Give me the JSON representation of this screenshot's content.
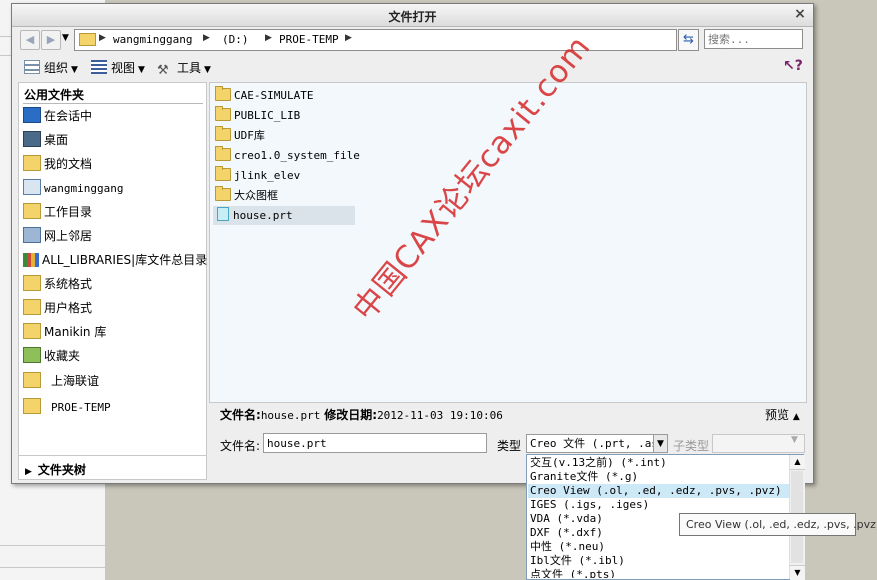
{
  "dialog": {
    "title": "文件打开",
    "close_icon": "close-icon"
  },
  "address": {
    "crumbs": [
      "wangminggang",
      "(D:)",
      "PROE-TEMP"
    ],
    "search_placeholder": "搜索..."
  },
  "toolbar": {
    "organize_label": "组织",
    "view_label": "视图",
    "tools_label": "工具"
  },
  "sidebar": {
    "title": "公用文件夹",
    "items": [
      {
        "label": "在会话中",
        "icon": "session-icon"
      },
      {
        "label": "桌面",
        "icon": "desktop-icon"
      },
      {
        "label": "我的文档",
        "icon": "my-documents-icon"
      },
      {
        "label": "wangminggang",
        "icon": "computer-icon"
      },
      {
        "label": "工作目录",
        "icon": "working-directory-icon"
      },
      {
        "label": "网上邻居",
        "icon": "network-icon"
      },
      {
        "label": "ALL_LIBRARIES|库文件总目录",
        "icon": "library-icon"
      },
      {
        "label": "系统格式",
        "icon": "folder-icon"
      },
      {
        "label": "用户格式",
        "icon": "folder-icon"
      },
      {
        "label": "Manikin 库",
        "icon": "folder-icon"
      },
      {
        "label": "收藏夹",
        "icon": "favorites-icon"
      },
      {
        "label": "上海联谊",
        "icon": "folder-icon"
      },
      {
        "label": "PROE-TEMP",
        "icon": "folder-icon"
      }
    ],
    "tree_toggle": "文件夹树"
  },
  "files": [
    {
      "name": "CAE-SIMULATE",
      "type": "folder"
    },
    {
      "name": "PUBLIC_LIB",
      "type": "folder"
    },
    {
      "name": "UDF库",
      "type": "folder"
    },
    {
      "name": "creo1.0_system_file",
      "type": "folder"
    },
    {
      "name": "jlink_elev",
      "type": "folder"
    },
    {
      "name": "大众图框",
      "type": "folder"
    },
    {
      "name": "house.prt",
      "type": "part",
      "selected": true
    }
  ],
  "info": {
    "filename_label": "文件名:",
    "filename": "house.prt",
    "modified_label": "修改日期:",
    "modified": "2012-11-03 19:10:06",
    "preview_label": "预览"
  },
  "filename_row": {
    "label": "文件名:",
    "value": "house.prt",
    "type_label": "类型",
    "type_value": "Creo 文件 (.prt, .as",
    "subtype_label": "子类型"
  },
  "type_options": [
    "交互(v.13之前) (*.int)",
    "Granite文件 (*.g)",
    "Creo View (.ol, .ed, .edz, .pvs, .pvz)",
    "IGES (.igs, .iges)",
    "VDA (*.vda)",
    "DXF (*.dxf)",
    "中性 (*.neu)",
    "Ibl文件 (*.ibl)",
    "点文件 (*.pts)"
  ],
  "tooltip": "Creo View (.ol, .ed, .edz, .pvs, .pvz)",
  "watermark": "中国CAX论坛caxit.com",
  "colors": {
    "selection": "#cde8f7",
    "folder": "#f3d36a",
    "watermark": "#d62828"
  }
}
